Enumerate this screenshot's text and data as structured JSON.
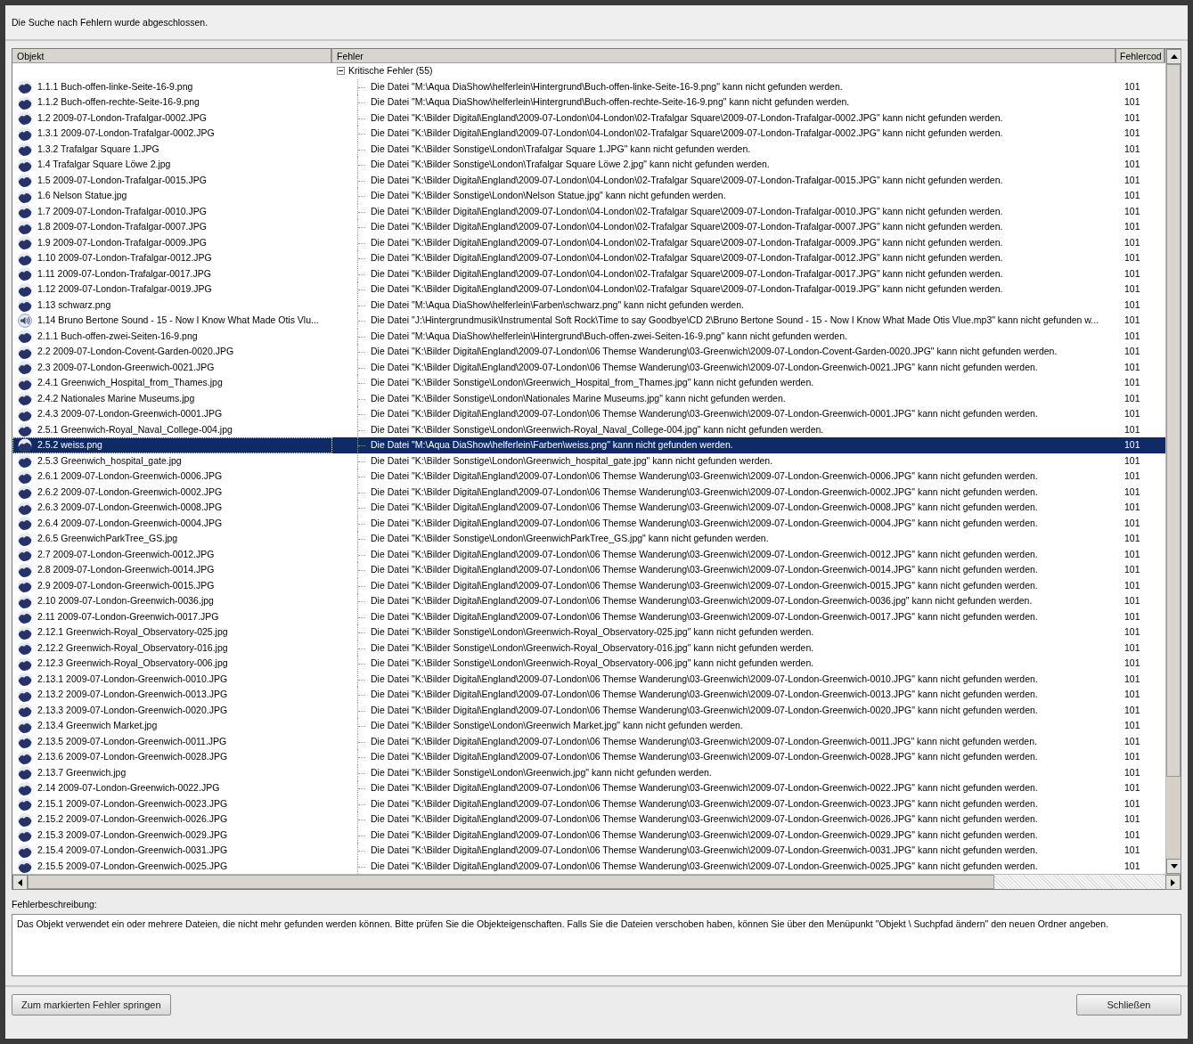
{
  "message": "Die Suche nach Fehlern wurde abgeschlossen.",
  "table": {
    "columns": [
      "Objekt",
      "Fehler",
      "Fehlercod"
    ],
    "group": {
      "label": "Kritische Fehler (55)",
      "expanded": true
    },
    "rows": [
      {
        "kind": "image",
        "object": "1.1.1 Buch-offen-linke-Seite-16-9.png",
        "error": "Die Datei \"M:\\Aqua DiaShow\\helferlein\\Hintergrund\\Buch-offen-linke-Seite-16-9.png\" kann nicht gefunden werden.",
        "code": "101",
        "selected": false
      },
      {
        "kind": "image",
        "object": "1.1.2 Buch-offen-rechte-Seite-16-9.png",
        "error": "Die Datei \"M:\\Aqua DiaShow\\helferlein\\Hintergrund\\Buch-offen-rechte-Seite-16-9.png\" kann nicht gefunden werden.",
        "code": "101",
        "selected": false
      },
      {
        "kind": "image",
        "object": "1.2 2009-07-London-Trafalgar-0002.JPG",
        "error": "Die Datei \"K:\\Bilder Digital\\England\\2009-07-London\\04-London\\02-Trafalgar Square\\2009-07-London-Trafalgar-0002.JPG\" kann nicht gefunden werden.",
        "code": "101",
        "selected": false
      },
      {
        "kind": "image",
        "object": "1.3.1 2009-07-London-Trafalgar-0002.JPG",
        "error": "Die Datei \"K:\\Bilder Digital\\England\\2009-07-London\\04-London\\02-Trafalgar Square\\2009-07-London-Trafalgar-0002.JPG\" kann nicht gefunden werden.",
        "code": "101",
        "selected": false
      },
      {
        "kind": "image",
        "object": "1.3.2 Trafalgar Square 1.JPG",
        "error": "Die Datei \"K:\\Bilder Sonstige\\London\\Trafalgar Square 1.JPG\" kann nicht gefunden werden.",
        "code": "101",
        "selected": false
      },
      {
        "kind": "image",
        "object": "1.4 Trafalgar Square Löwe 2.jpg",
        "error": "Die Datei \"K:\\Bilder Sonstige\\London\\Trafalgar Square Löwe 2.jpg\" kann nicht gefunden werden.",
        "code": "101",
        "selected": false
      },
      {
        "kind": "image",
        "object": "1.5 2009-07-London-Trafalgar-0015.JPG",
        "error": "Die Datei \"K:\\Bilder Digital\\England\\2009-07-London\\04-London\\02-Trafalgar Square\\2009-07-London-Trafalgar-0015.JPG\" kann nicht gefunden werden.",
        "code": "101",
        "selected": false
      },
      {
        "kind": "image",
        "object": "1.6 Nelson Statue.jpg",
        "error": "Die Datei \"K:\\Bilder Sonstige\\London\\Nelson Statue.jpg\" kann nicht gefunden werden.",
        "code": "101",
        "selected": false
      },
      {
        "kind": "image",
        "object": "1.7 2009-07-London-Trafalgar-0010.JPG",
        "error": "Die Datei \"K:\\Bilder Digital\\England\\2009-07-London\\04-London\\02-Trafalgar Square\\2009-07-London-Trafalgar-0010.JPG\" kann nicht gefunden werden.",
        "code": "101",
        "selected": false
      },
      {
        "kind": "image",
        "object": "1.8 2009-07-London-Trafalgar-0007.JPG",
        "error": "Die Datei \"K:\\Bilder Digital\\England\\2009-07-London\\04-London\\02-Trafalgar Square\\2009-07-London-Trafalgar-0007.JPG\" kann nicht gefunden werden.",
        "code": "101",
        "selected": false
      },
      {
        "kind": "image",
        "object": "1.9 2009-07-London-Trafalgar-0009.JPG",
        "error": "Die Datei \"K:\\Bilder Digital\\England\\2009-07-London\\04-London\\02-Trafalgar Square\\2009-07-London-Trafalgar-0009.JPG\" kann nicht gefunden werden.",
        "code": "101",
        "selected": false
      },
      {
        "kind": "image",
        "object": "1.10 2009-07-London-Trafalgar-0012.JPG",
        "error": "Die Datei \"K:\\Bilder Digital\\England\\2009-07-London\\04-London\\02-Trafalgar Square\\2009-07-London-Trafalgar-0012.JPG\" kann nicht gefunden werden.",
        "code": "101",
        "selected": false
      },
      {
        "kind": "image",
        "object": "1.11 2009-07-London-Trafalgar-0017.JPG",
        "error": "Die Datei \"K:\\Bilder Digital\\England\\2009-07-London\\04-London\\02-Trafalgar Square\\2009-07-London-Trafalgar-0017.JPG\" kann nicht gefunden werden.",
        "code": "101",
        "selected": false
      },
      {
        "kind": "image",
        "object": "1.12 2009-07-London-Trafalgar-0019.JPG",
        "error": "Die Datei \"K:\\Bilder Digital\\England\\2009-07-London\\04-London\\02-Trafalgar Square\\2009-07-London-Trafalgar-0019.JPG\" kann nicht gefunden werden.",
        "code": "101",
        "selected": false
      },
      {
        "kind": "image",
        "object": "1.13 schwarz.png",
        "error": "Die Datei \"M:\\Aqua DiaShow\\helferlein\\Farben\\schwarz.png\" kann nicht gefunden werden.",
        "code": "101",
        "selected": false
      },
      {
        "kind": "audio",
        "object": "1.14 Bruno Bertone Sound - 15 - Now I Know What Made Otis Vlu...",
        "error": "Die Datei \"J:\\Hintergrundmusik\\Instrumental Soft Rock\\Time to say Goodbye\\CD 2\\Bruno Bertone Sound - 15 - Now I Know What Made Otis Vlue.mp3\" kann nicht gefunden w...",
        "code": "101",
        "selected": false
      },
      {
        "kind": "image",
        "object": "2.1.1 Buch-offen-zwei-Seiten-16-9.png",
        "error": "Die Datei \"M:\\Aqua DiaShow\\helferlein\\Hintergrund\\Buch-offen-zwei-Seiten-16-9.png\" kann nicht gefunden werden.",
        "code": "101",
        "selected": false
      },
      {
        "kind": "image",
        "object": "2.2 2009-07-London-Covent-Garden-0020.JPG",
        "error": "Die Datei \"K:\\Bilder Digital\\England\\2009-07-London\\06 Themse Wanderung\\03-Greenwich\\2009-07-London-Covent-Garden-0020.JPG\" kann nicht gefunden werden.",
        "code": "101",
        "selected": false
      },
      {
        "kind": "image",
        "object": "2.3 2009-07-London-Greenwich-0021.JPG",
        "error": "Die Datei \"K:\\Bilder Digital\\England\\2009-07-London\\06 Themse Wanderung\\03-Greenwich\\2009-07-London-Greenwich-0021.JPG\" kann nicht gefunden werden.",
        "code": "101",
        "selected": false
      },
      {
        "kind": "image",
        "object": "2.4.1 Greenwich_Hospital_from_Thames.jpg",
        "error": "Die Datei \"K:\\Bilder Sonstige\\London\\Greenwich_Hospital_from_Thames.jpg\" kann nicht gefunden werden.",
        "code": "101",
        "selected": false
      },
      {
        "kind": "image",
        "object": "2.4.2 Nationales Marine Museums.jpg",
        "error": "Die Datei \"K:\\Bilder Sonstige\\London\\Nationales Marine Museums.jpg\" kann nicht gefunden werden.",
        "code": "101",
        "selected": false
      },
      {
        "kind": "image",
        "object": "2.4.3 2009-07-London-Greenwich-0001.JPG",
        "error": "Die Datei \"K:\\Bilder Digital\\England\\2009-07-London\\06 Themse Wanderung\\03-Greenwich\\2009-07-London-Greenwich-0001.JPG\" kann nicht gefunden werden.",
        "code": "101",
        "selected": false
      },
      {
        "kind": "image",
        "object": "2.5.1 Greenwich-Royal_Naval_College-004.jpg",
        "error": "Die Datei \"K:\\Bilder Sonstige\\London\\Greenwich-Royal_Naval_College-004.jpg\" kann nicht gefunden werden.",
        "code": "101",
        "selected": false
      },
      {
        "kind": "image",
        "object": "2.5.2 weiss.png",
        "error": "Die Datei \"M:\\Aqua DiaShow\\helferlein\\Farben\\weiss.png\" kann nicht gefunden werden.",
        "code": "101",
        "selected": true
      },
      {
        "kind": "image",
        "object": "2.5.3 Greenwich_hospital_gate.jpg",
        "error": "Die Datei \"K:\\Bilder Sonstige\\London\\Greenwich_hospital_gate.jpg\" kann nicht gefunden werden.",
        "code": "101",
        "selected": false
      },
      {
        "kind": "image",
        "object": "2.6.1 2009-07-London-Greenwich-0006.JPG",
        "error": "Die Datei \"K:\\Bilder Digital\\England\\2009-07-London\\06 Themse Wanderung\\03-Greenwich\\2009-07-London-Greenwich-0006.JPG\" kann nicht gefunden werden.",
        "code": "101",
        "selected": false
      },
      {
        "kind": "image",
        "object": "2.6.2 2009-07-London-Greenwich-0002.JPG",
        "error": "Die Datei \"K:\\Bilder Digital\\England\\2009-07-London\\06 Themse Wanderung\\03-Greenwich\\2009-07-London-Greenwich-0002.JPG\" kann nicht gefunden werden.",
        "code": "101",
        "selected": false
      },
      {
        "kind": "image",
        "object": "2.6.3 2009-07-London-Greenwich-0008.JPG",
        "error": "Die Datei \"K:\\Bilder Digital\\England\\2009-07-London\\06 Themse Wanderung\\03-Greenwich\\2009-07-London-Greenwich-0008.JPG\" kann nicht gefunden werden.",
        "code": "101",
        "selected": false
      },
      {
        "kind": "image",
        "object": "2.6.4 2009-07-London-Greenwich-0004.JPG",
        "error": "Die Datei \"K:\\Bilder Digital\\England\\2009-07-London\\06 Themse Wanderung\\03-Greenwich\\2009-07-London-Greenwich-0004.JPG\" kann nicht gefunden werden.",
        "code": "101",
        "selected": false
      },
      {
        "kind": "image",
        "object": "2.6.5 GreenwichParkTree_GS.jpg",
        "error": "Die Datei \"K:\\Bilder Sonstige\\London\\GreenwichParkTree_GS.jpg\" kann nicht gefunden werden.",
        "code": "101",
        "selected": false
      },
      {
        "kind": "image",
        "object": "2.7 2009-07-London-Greenwich-0012.JPG",
        "error": "Die Datei \"K:\\Bilder Digital\\England\\2009-07-London\\06 Themse Wanderung\\03-Greenwich\\2009-07-London-Greenwich-0012.JPG\" kann nicht gefunden werden.",
        "code": "101",
        "selected": false
      },
      {
        "kind": "image",
        "object": "2.8 2009-07-London-Greenwich-0014.JPG",
        "error": "Die Datei \"K:\\Bilder Digital\\England\\2009-07-London\\06 Themse Wanderung\\03-Greenwich\\2009-07-London-Greenwich-0014.JPG\" kann nicht gefunden werden.",
        "code": "101",
        "selected": false
      },
      {
        "kind": "image",
        "object": "2.9 2009-07-London-Greenwich-0015.JPG",
        "error": "Die Datei \"K:\\Bilder Digital\\England\\2009-07-London\\06 Themse Wanderung\\03-Greenwich\\2009-07-London-Greenwich-0015.JPG\" kann nicht gefunden werden.",
        "code": "101",
        "selected": false
      },
      {
        "kind": "image",
        "object": "2.10 2009-07-London-Greenwich-0036.jpg",
        "error": "Die Datei \"K:\\Bilder Digital\\England\\2009-07-London\\06 Themse Wanderung\\03-Greenwich\\2009-07-London-Greenwich-0036.jpg\" kann nicht gefunden werden.",
        "code": "101",
        "selected": false
      },
      {
        "kind": "image",
        "object": "2.11 2009-07-London-Greenwich-0017.JPG",
        "error": "Die Datei \"K:\\Bilder Digital\\England\\2009-07-London\\06 Themse Wanderung\\03-Greenwich\\2009-07-London-Greenwich-0017.JPG\" kann nicht gefunden werden.",
        "code": "101",
        "selected": false
      },
      {
        "kind": "image",
        "object": "2.12.1 Greenwich-Royal_Observatory-025.jpg",
        "error": "Die Datei \"K:\\Bilder Sonstige\\London\\Greenwich-Royal_Observatory-025.jpg\" kann nicht gefunden werden.",
        "code": "101",
        "selected": false
      },
      {
        "kind": "image",
        "object": "2.12.2 Greenwich-Royal_Observatory-016.jpg",
        "error": "Die Datei \"K:\\Bilder Sonstige\\London\\Greenwich-Royal_Observatory-016.jpg\" kann nicht gefunden werden.",
        "code": "101",
        "selected": false
      },
      {
        "kind": "image",
        "object": "2.12.3 Greenwich-Royal_Observatory-006.jpg",
        "error": "Die Datei \"K:\\Bilder Sonstige\\London\\Greenwich-Royal_Observatory-006.jpg\" kann nicht gefunden werden.",
        "code": "101",
        "selected": false
      },
      {
        "kind": "image",
        "object": "2.13.1 2009-07-London-Greenwich-0010.JPG",
        "error": "Die Datei \"K:\\Bilder Digital\\England\\2009-07-London\\06 Themse Wanderung\\03-Greenwich\\2009-07-London-Greenwich-0010.JPG\" kann nicht gefunden werden.",
        "code": "101",
        "selected": false
      },
      {
        "kind": "image",
        "object": "2.13.2 2009-07-London-Greenwich-0013.JPG",
        "error": "Die Datei \"K:\\Bilder Digital\\England\\2009-07-London\\06 Themse Wanderung\\03-Greenwich\\2009-07-London-Greenwich-0013.JPG\" kann nicht gefunden werden.",
        "code": "101",
        "selected": false
      },
      {
        "kind": "image",
        "object": "2.13.3 2009-07-London-Greenwich-0020.JPG",
        "error": "Die Datei \"K:\\Bilder Digital\\England\\2009-07-London\\06 Themse Wanderung\\03-Greenwich\\2009-07-London-Greenwich-0020.JPG\" kann nicht gefunden werden.",
        "code": "101",
        "selected": false
      },
      {
        "kind": "image",
        "object": "2.13.4 Greenwich Market.jpg",
        "error": "Die Datei \"K:\\Bilder Sonstige\\London\\Greenwich Market.jpg\" kann nicht gefunden werden.",
        "code": "101",
        "selected": false
      },
      {
        "kind": "image",
        "object": "2.13.5 2009-07-London-Greenwich-0011.JPG",
        "error": "Die Datei \"K:\\Bilder Digital\\England\\2009-07-London\\06 Themse Wanderung\\03-Greenwich\\2009-07-London-Greenwich-0011.JPG\" kann nicht gefunden werden.",
        "code": "101",
        "selected": false
      },
      {
        "kind": "image",
        "object": "2.13.6 2009-07-London-Greenwich-0028.JPG",
        "error": "Die Datei \"K:\\Bilder Digital\\England\\2009-07-London\\06 Themse Wanderung\\03-Greenwich\\2009-07-London-Greenwich-0028.JPG\" kann nicht gefunden werden.",
        "code": "101",
        "selected": false
      },
      {
        "kind": "image",
        "object": "2.13.7 Greenwich.jpg",
        "error": "Die Datei \"K:\\Bilder Sonstige\\London\\Greenwich.jpg\" kann nicht gefunden werden.",
        "code": "101",
        "selected": false
      },
      {
        "kind": "image",
        "object": "2.14 2009-07-London-Greenwich-0022.JPG",
        "error": "Die Datei \"K:\\Bilder Digital\\England\\2009-07-London\\06 Themse Wanderung\\03-Greenwich\\2009-07-London-Greenwich-0022.JPG\" kann nicht gefunden werden.",
        "code": "101",
        "selected": false
      },
      {
        "kind": "image",
        "object": "2.15.1 2009-07-London-Greenwich-0023.JPG",
        "error": "Die Datei \"K:\\Bilder Digital\\England\\2009-07-London\\06 Themse Wanderung\\03-Greenwich\\2009-07-London-Greenwich-0023.JPG\" kann nicht gefunden werden.",
        "code": "101",
        "selected": false
      },
      {
        "kind": "image",
        "object": "2.15.2 2009-07-London-Greenwich-0026.JPG",
        "error": "Die Datei \"K:\\Bilder Digital\\England\\2009-07-London\\06 Themse Wanderung\\03-Greenwich\\2009-07-London-Greenwich-0026.JPG\" kann nicht gefunden werden.",
        "code": "101",
        "selected": false
      },
      {
        "kind": "image",
        "object": "2.15.3 2009-07-London-Greenwich-0029.JPG",
        "error": "Die Datei \"K:\\Bilder Digital\\England\\2009-07-London\\06 Themse Wanderung\\03-Greenwich\\2009-07-London-Greenwich-0029.JPG\" kann nicht gefunden werden.",
        "code": "101",
        "selected": false
      },
      {
        "kind": "image",
        "object": "2.15.4 2009-07-London-Greenwich-0031.JPG",
        "error": "Die Datei \"K:\\Bilder Digital\\England\\2009-07-London\\06 Themse Wanderung\\03-Greenwich\\2009-07-London-Greenwich-0031.JPG\" kann nicht gefunden werden.",
        "code": "101",
        "selected": false
      },
      {
        "kind": "image",
        "object": "2.15.5 2009-07-London-Greenwich-0025.JPG",
        "error": "Die Datei \"K:\\Bilder Digital\\England\\2009-07-London\\06 Themse Wanderung\\03-Greenwich\\2009-07-London-Greenwich-0025.JPG\" kann nicht gefunden werden.",
        "code": "101",
        "selected": false
      }
    ]
  },
  "description": {
    "label": "Fehlerbeschreibung:",
    "text": "Das Objekt verwendet ein oder mehrere Dateien, die nicht mehr gefunden werden können. Bitte prüfen Sie die Objekteigenschaften. Falls Sie die Dateien verschoben haben, können Sie über den Menüpunkt \"Objekt \\ Suchpfad ändern\" den neuen Ordner angeben."
  },
  "buttons": [
    "Zum markierten Fehler springen",
    "Schließen"
  ]
}
